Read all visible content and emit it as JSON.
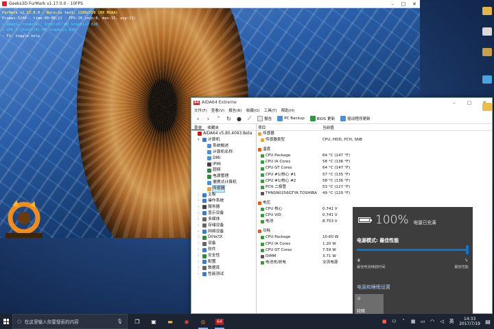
{
  "furmark": {
    "title": "Geeks3D FurMark v1.17.0.0 - 10FPS",
    "osd": [
      "FurMark v1.17.0.0 - Burn-in test, 1280x720 (8X MSAA)",
      "Frames:5240 - time:00:08:11 - FPS:10 (min:8, max:15, avg:11)",
      "> OpenGL renderer: Intel(R) HD Graphics 620",
      "> GPU 1 (Intel(R) HD Graphics 620)",
      "- F1: toggle help"
    ],
    "logo_text": "FurMark"
  },
  "aida": {
    "title": "AIDA64 Extreme",
    "logo": "64",
    "menu": [
      "文件(F)",
      "查看(V)",
      "报告(R)",
      "收藏(O)",
      "工具(T)",
      "帮助(H)"
    ],
    "toolbar": {
      "report": "报告",
      "pcbackup": "PC Backup",
      "bios": "BIOS 更新",
      "driver": "驱动程序更新"
    },
    "panel_tabs": [
      "菜单",
      "收藏夹"
    ],
    "tree": [
      {
        "label": "AIDA64 v5.80.4093 Beta",
        "level": 0,
        "arrow": "",
        "color": "#c81818"
      },
      {
        "label": "计算机",
        "level": 1,
        "arrow": "▾",
        "color": "#3a7bd5"
      },
      {
        "label": "系统概述",
        "level": 2,
        "arrow": "",
        "color": "#4a90d9"
      },
      {
        "label": "计算机名称",
        "level": 2,
        "arrow": "",
        "color": "#4a90d9"
      },
      {
        "label": "DMI",
        "level": 2,
        "arrow": "",
        "color": "#4a90d9"
      },
      {
        "label": "IPMI",
        "level": 2,
        "arrow": "",
        "color": "#444444"
      },
      {
        "label": "超频",
        "level": 2,
        "arrow": "",
        "color": "#2b8a3e"
      },
      {
        "label": "电源管理",
        "level": 2,
        "arrow": "",
        "color": "#2b8a3e"
      },
      {
        "label": "便携式计算机",
        "level": 2,
        "arrow": "",
        "color": "#4a90d9"
      },
      {
        "label": "传感器",
        "level": 2,
        "arrow": "",
        "color": "#e8a33a",
        "selected": true
      },
      {
        "label": "主板",
        "level": 1,
        "arrow": "›",
        "color": "#3a7bd5"
      },
      {
        "label": "操作系统",
        "level": 1,
        "arrow": "›",
        "color": "#3a7bd5"
      },
      {
        "label": "服务器",
        "level": 1,
        "arrow": "›",
        "color": "#444444"
      },
      {
        "label": "显示设备",
        "level": 1,
        "arrow": "›",
        "color": "#3a7bd5"
      },
      {
        "label": "多媒体",
        "level": 1,
        "arrow": "›",
        "color": "#666666"
      },
      {
        "label": "存储设备",
        "level": 1,
        "arrow": "›",
        "color": "#666666"
      },
      {
        "label": "网络设备",
        "level": 1,
        "arrow": "›",
        "color": "#3a7bd5"
      },
      {
        "label": "DirectX",
        "level": 1,
        "arrow": "›",
        "color": "#2b8a3e"
      },
      {
        "label": "设备",
        "level": 1,
        "arrow": "›",
        "color": "#666666"
      },
      {
        "label": "软件",
        "level": 1,
        "arrow": "›",
        "color": "#3a7bd5"
      },
      {
        "label": "安全性",
        "level": 1,
        "arrow": "›",
        "color": "#2b8a3e"
      },
      {
        "label": "配置",
        "level": 1,
        "arrow": "›",
        "color": "#3a7bd5"
      },
      {
        "label": "数据库",
        "level": 1,
        "arrow": "›",
        "color": "#666666"
      },
      {
        "label": "性能测试",
        "level": 1,
        "arrow": "›",
        "color": "#3a7bd5"
      }
    ],
    "columns": [
      "项目",
      "当前值"
    ],
    "rows": [
      {
        "type": "section",
        "key": "传感器",
        "value": "",
        "color": "#e8a33a"
      },
      {
        "type": "item",
        "key": "传感器类型",
        "value": "CPU, HDD, PCH, SNB",
        "color": "#e8a33a"
      },
      {
        "type": "gap"
      },
      {
        "type": "section",
        "key": "温度",
        "value": "",
        "color": "#e25a1c"
      },
      {
        "type": "item",
        "key": "CPU Package",
        "value": "64 °C  (147 °F)",
        "color": "#3a9a3a"
      },
      {
        "type": "item",
        "key": "CPU IA Cores",
        "value": "58 °C  (136 °F)",
        "color": "#3a9a3a"
      },
      {
        "type": "item",
        "key": "CPU GT Cores",
        "value": "64 °C  (147 °F)",
        "color": "#3a9a3a"
      },
      {
        "type": "item",
        "key": "CPU #1/核心 #1",
        "value": "57 °C  (135 °F)",
        "color": "#3a9a3a"
      },
      {
        "type": "item",
        "key": "CPU #1/核心 #2",
        "value": "58 °C  (136 °F)",
        "color": "#3a9a3a"
      },
      {
        "type": "item",
        "key": "PCH 二极管",
        "value": "53 °C  (127 °F)",
        "color": "#3a9a3a"
      },
      {
        "type": "item",
        "key": "THNSN0256GTYA TOSHIBA",
        "value": "49 °C  (120 °F)",
        "color": "#555555"
      },
      {
        "type": "gap"
      },
      {
        "type": "section",
        "key": "电压",
        "value": "",
        "color": "#e25a1c"
      },
      {
        "type": "item",
        "key": "CPU 核心",
        "value": "0.741 V",
        "color": "#3a9a3a"
      },
      {
        "type": "item",
        "key": "CPU VID",
        "value": "0.741 V",
        "color": "#3a9a3a"
      },
      {
        "type": "item",
        "key": "电池",
        "value": "8.753 V",
        "color": "#3a9a3a"
      },
      {
        "type": "gap"
      },
      {
        "type": "section",
        "key": "功耗",
        "value": "",
        "color": "#e25a1c"
      },
      {
        "type": "item",
        "key": "CPU Package",
        "value": "10.60 W",
        "color": "#3a9a3a"
      },
      {
        "type": "item",
        "key": "CPU IA Cores",
        "value": "1.20 W",
        "color": "#3a9a3a"
      },
      {
        "type": "item",
        "key": "CPU GT Cores",
        "value": "7.59 W",
        "color": "#3a9a3a"
      },
      {
        "type": "item",
        "key": "DIMM",
        "value": "3.71 W",
        "color": "#555555"
      },
      {
        "type": "item",
        "key": "电池充/放电",
        "value": "交流电源",
        "color": "#3a9a3a"
      }
    ]
  },
  "battery": {
    "percent": "100%",
    "status": "电量已充满",
    "mode_label": "电源模式: 最佳性能",
    "mode_level": 1.0,
    "left_label": "最佳电池续航时间",
    "right_label": "最佳性能",
    "link": "电源和睡眠设置",
    "brightness_label": "较暗"
  },
  "taskbar": {
    "search_placeholder": "在这里输入你要搜索的内容",
    "apps": [
      "task-view",
      "store",
      "file-explorer",
      "chrome",
      "furmark",
      "aida64"
    ],
    "time": "14:33",
    "date": "2017/7/19",
    "ime": "英"
  },
  "colors": {
    "accent": "#0078d7",
    "osd_yellow": "#ffe24a",
    "osd_cyan": "#58d8ff",
    "aida_red": "#c81818"
  }
}
